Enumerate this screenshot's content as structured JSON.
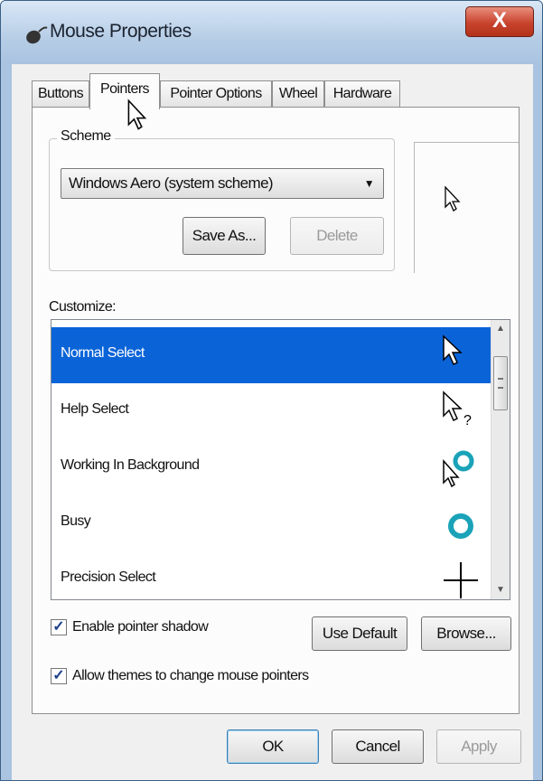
{
  "window": {
    "title": "Mouse Properties",
    "close_label": "X"
  },
  "tabs": [
    {
      "label": "Buttons"
    },
    {
      "label": "Pointers"
    },
    {
      "label": "Pointer Options"
    },
    {
      "label": "Wheel"
    },
    {
      "label": "Hardware"
    }
  ],
  "active_tab": "Pointers",
  "scheme": {
    "group_label": "Scheme",
    "selected": "Windows Aero (system scheme)",
    "save_as_label": "Save As...",
    "delete_label": "Delete"
  },
  "customize": {
    "label": "Customize:",
    "items": [
      {
        "label": "Normal Select",
        "icon": "arrow-cursor-icon",
        "selected": true
      },
      {
        "label": "Help Select",
        "icon": "help-cursor-icon"
      },
      {
        "label": "Working In Background",
        "icon": "working-cursor-icon"
      },
      {
        "label": "Busy",
        "icon": "busy-ring-icon"
      },
      {
        "label": "Precision Select",
        "icon": "crosshair-icon"
      }
    ]
  },
  "options": {
    "shadow_label": "Enable pointer shadow",
    "shadow_checked": true,
    "use_default_label": "Use Default",
    "browse_label": "Browse...",
    "themes_label": "Allow themes to change mouse pointers",
    "themes_checked": true
  },
  "footer": {
    "ok_label": "OK",
    "cancel_label": "Cancel",
    "apply_label": "Apply"
  },
  "colors": {
    "selection": "#0a64d8",
    "close_button": "#c8432d",
    "busy_ring": "#1aa3b8"
  }
}
